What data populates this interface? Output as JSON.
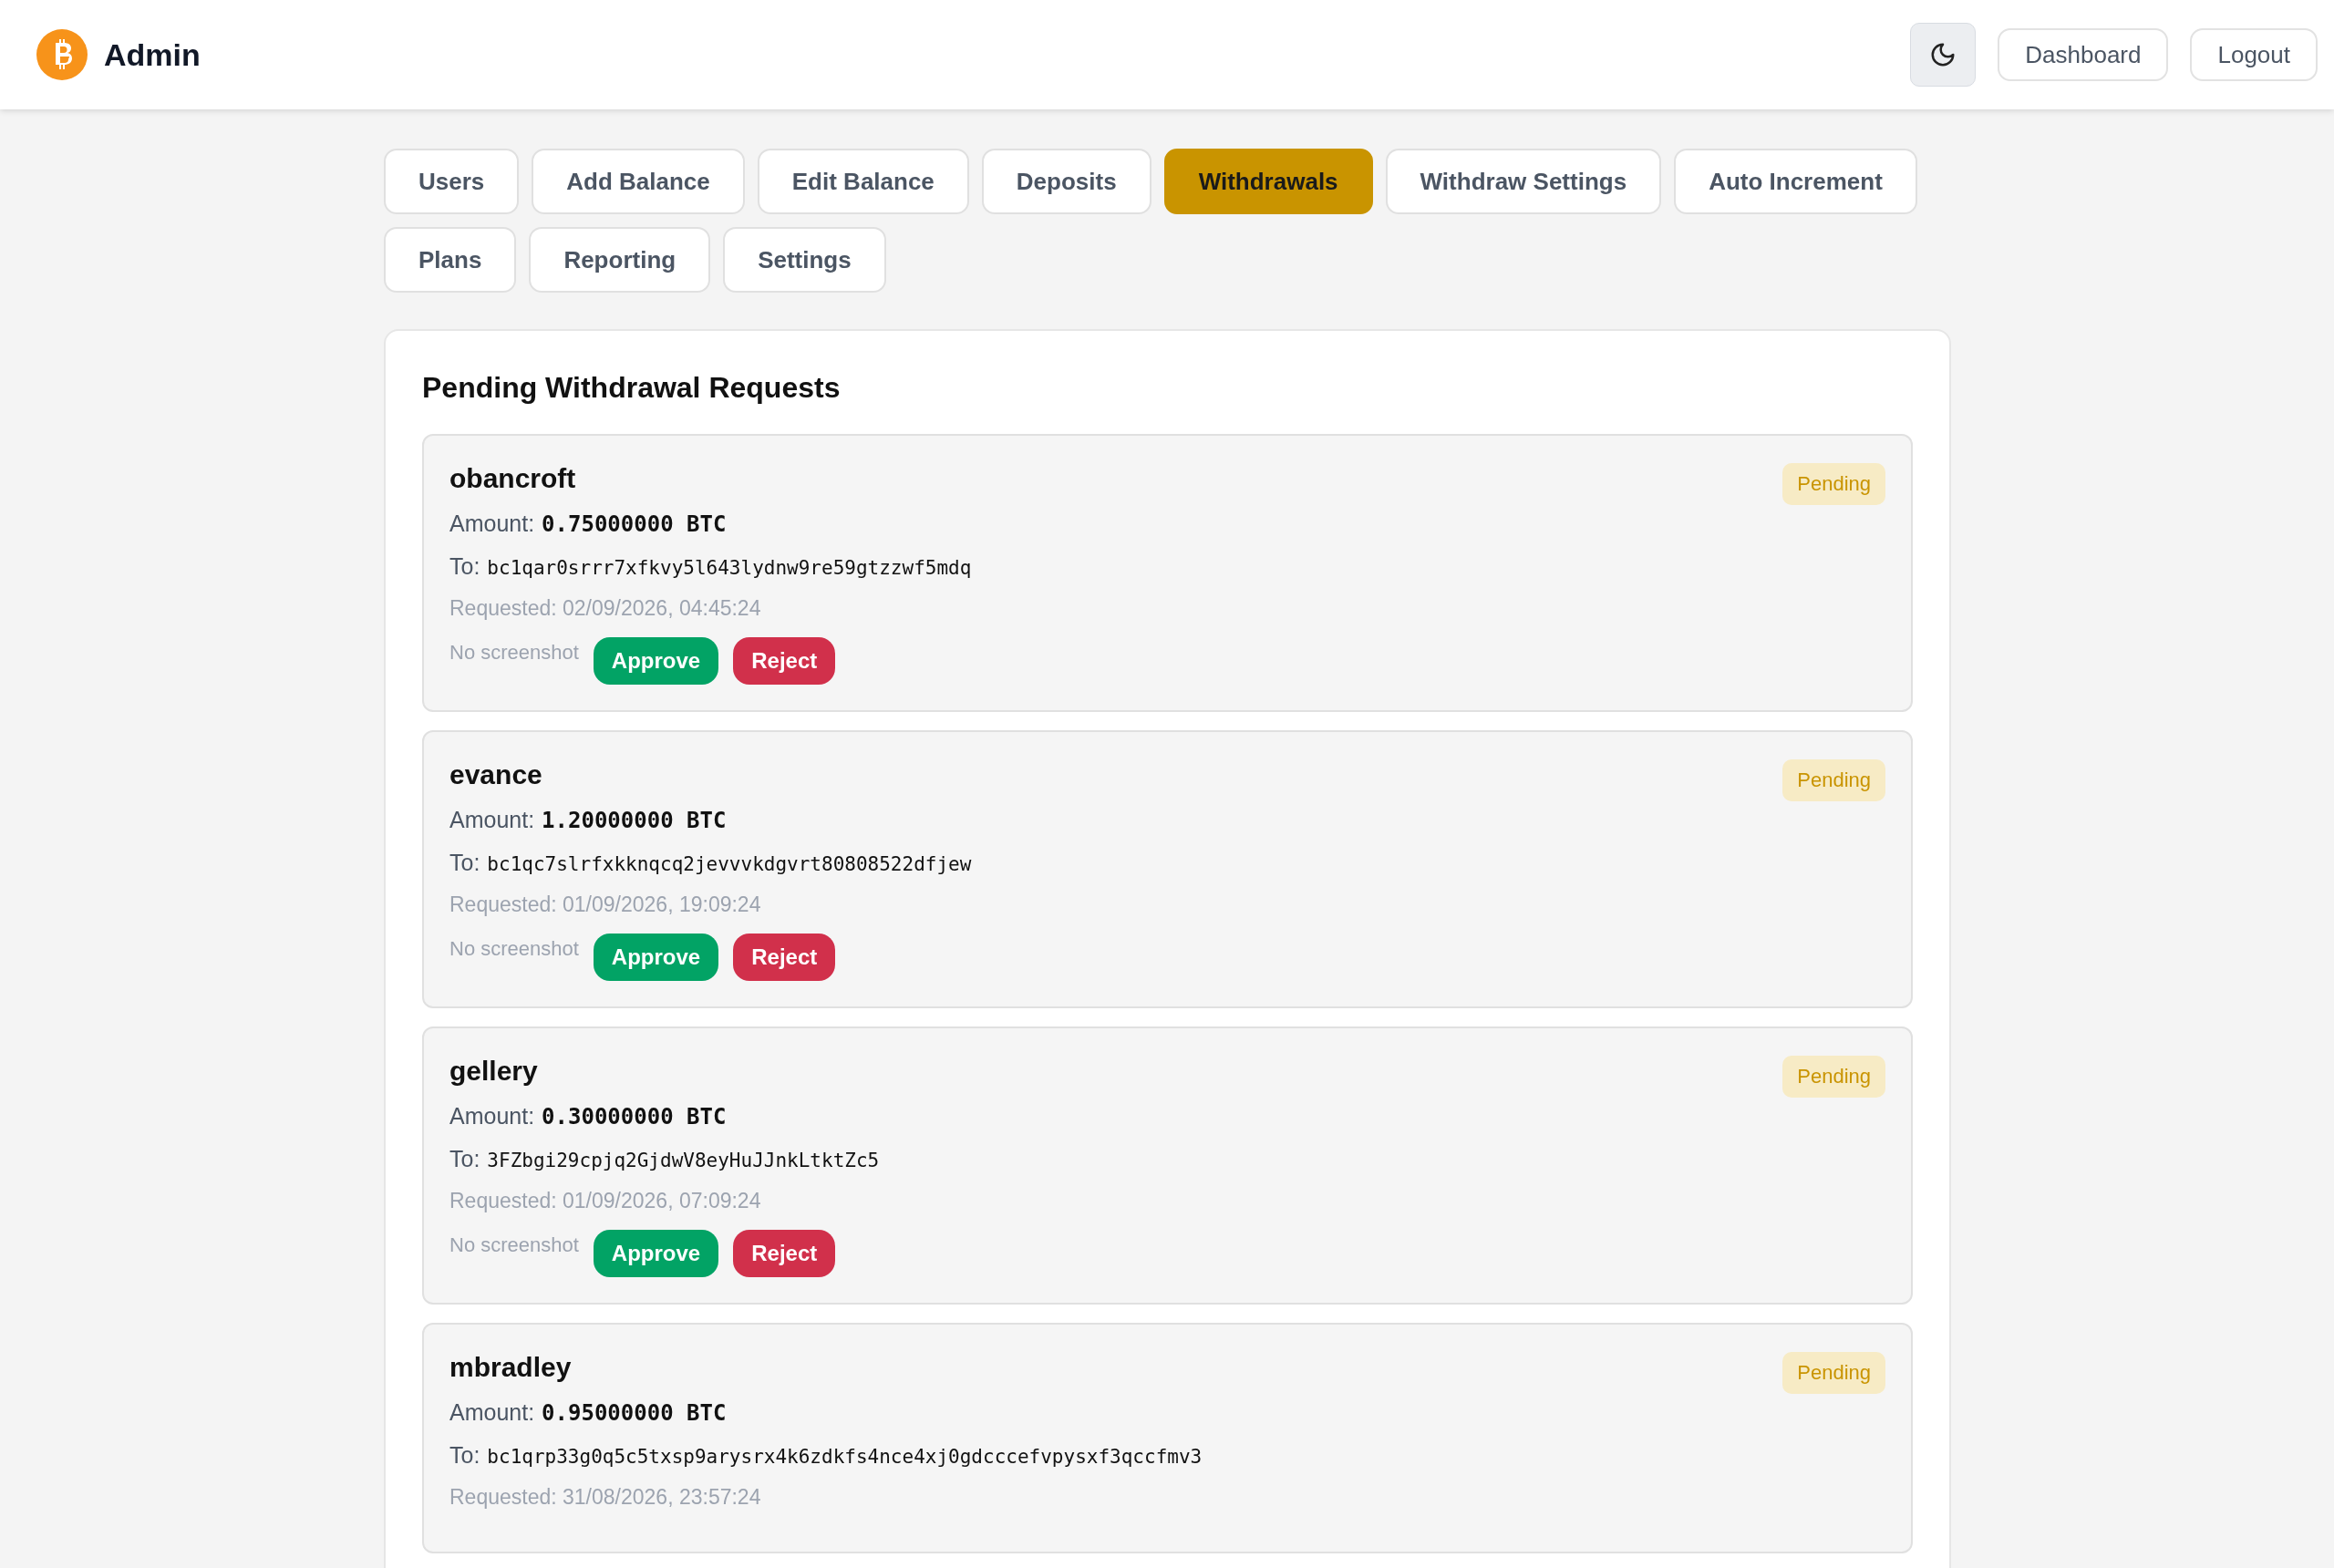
{
  "header": {
    "title": "Admin",
    "buttons": [
      "Dashboard",
      "Logout"
    ]
  },
  "tabs": [
    {
      "label": "Users",
      "selected": false
    },
    {
      "label": "Add Balance",
      "selected": false
    },
    {
      "label": "Edit Balance",
      "selected": false
    },
    {
      "label": "Deposits",
      "selected": false
    },
    {
      "label": "Withdrawals",
      "selected": true
    },
    {
      "label": "Withdraw Settings",
      "selected": false
    },
    {
      "label": "Auto Increment",
      "selected": false
    },
    {
      "label": "Plans",
      "selected": false
    },
    {
      "label": "Reporting",
      "selected": false
    },
    {
      "label": "Settings",
      "selected": false
    }
  ],
  "panel": {
    "title": "Pending Withdrawal Requests",
    "requests": [
      {
        "user": "obancroft",
        "status": "Pending",
        "amount_label": "Amount:",
        "amount": "0.75000000 BTC",
        "to_label": "To:",
        "address": "bc1qar0srrr7xfkvy5l643lydnw9re59gtzzwf5mdq",
        "requested": "Requested: 02/09/2026, 04:45:24",
        "screenshot": "No screenshot",
        "actions": [
          "Approve",
          "Reject"
        ]
      },
      {
        "user": "evance",
        "status": "Pending",
        "amount_label": "Amount:",
        "amount": "1.20000000 BTC",
        "to_label": "To:",
        "address": "bc1qc7slrfxkknqcq2jevvvkdgvrt80808522dfjew",
        "requested": "Requested: 01/09/2026, 19:09:24",
        "screenshot": "No screenshot",
        "actions": [
          "Approve",
          "Reject"
        ]
      },
      {
        "user": "gellery",
        "status": "Pending",
        "amount_label": "Amount:",
        "amount": "0.30000000 BTC",
        "to_label": "To:",
        "address": "3FZbgi29cpjq2GjdwV8eyHuJJnkLtktZc5",
        "requested": "Requested: 01/09/2026, 07:09:24",
        "screenshot": "No screenshot",
        "actions": [
          "Approve",
          "Reject"
        ]
      },
      {
        "user": "mbradley",
        "status": "Pending",
        "amount_label": "Amount:",
        "amount": "0.95000000 BTC",
        "to_label": "To:",
        "address": "bc1qrp33g0q5c5txsp9arysrx4k6zdkfs4nce4xj0gdcccefvpysxf3qccfmv3",
        "requested": "Requested: 31/08/2026, 23:57:24"
      }
    ]
  }
}
